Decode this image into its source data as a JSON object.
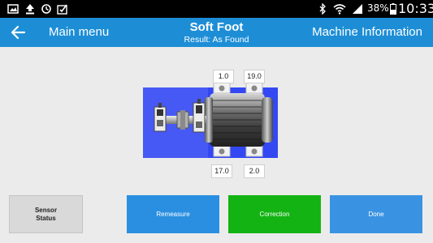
{
  "status_bar": {
    "battery": "38%",
    "time": "10:33",
    "icons": [
      "gallery-icon",
      "upload-icon",
      "sync-icon",
      "checklist-icon",
      "bluetooth-icon",
      "wifi-icon",
      "signal-icon",
      "battery-icon"
    ]
  },
  "app_bar": {
    "back_icon": "back-arrow-icon",
    "main_menu": "Main menu",
    "title": "Soft Foot",
    "subtitle": "Result: As Found",
    "machine_info": "Machine Information",
    "background_color": "#1d8ed6"
  },
  "machine": {
    "feet": {
      "top_left": "1.0",
      "top_right": "19.0",
      "bottom_left": "17.0",
      "bottom_right": "2.0"
    },
    "base_color": "#3348f2"
  },
  "buttons": {
    "sensor_status_line1": "Sensor",
    "sensor_status_line2": "Status",
    "remeasure": "Remeasure",
    "correction": "Correction",
    "done": "Done"
  },
  "colors": {
    "remeasure": "#2a8fe0",
    "correction": "#13b313",
    "done": "#3a93e2"
  }
}
